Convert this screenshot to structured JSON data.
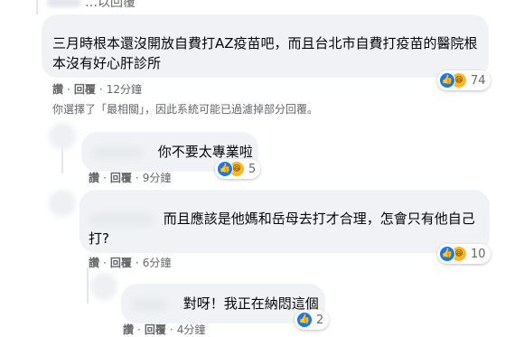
{
  "top_partial": {
    "text": "…以回覆"
  },
  "comments": [
    {
      "text_line1": "三月時根本還沒開放自費打AZ疫苗吧，而且台北市自費打疫苗的醫院根",
      "text_line2": "本沒有好心肝診所",
      "like": "讚",
      "reply": "回覆",
      "time": "12分鐘",
      "reaction_count": "74"
    },
    {
      "text": "你不要太專業啦",
      "like": "讚",
      "reply": "回覆",
      "time": "9分鐘",
      "reaction_count": "5"
    },
    {
      "text_line1": "而且應該是他媽和岳母去打才合理，怎會只有他自己",
      "text_line2": "打?",
      "like": "讚",
      "reply": "回覆",
      "time": "6分鐘",
      "reaction_count": "10"
    },
    {
      "text": "對呀！我正在納悶這個",
      "like": "讚",
      "reply": "回覆",
      "time": "4分鐘",
      "reaction_count": "2"
    }
  ],
  "filter_notice": "你選擇了「最相關」，因此系統可能已過濾掉部分回覆。",
  "reaction_icons": {
    "like": "like-icon",
    "haha": "haha-icon"
  },
  "colors": {
    "like_blue": "#1877f2",
    "haha_yellow": "#f7b928",
    "bubble_gray": "#f0f2f5"
  }
}
